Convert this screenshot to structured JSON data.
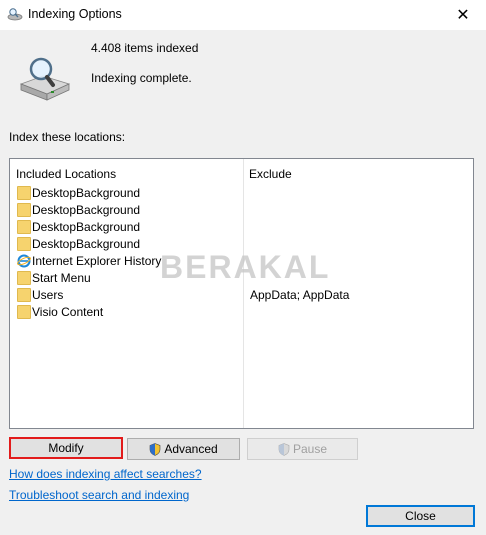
{
  "window": {
    "title": "Indexing Options",
    "close_glyph": "✕"
  },
  "status": {
    "items_indexed": "4.408 items indexed",
    "state": "Indexing complete."
  },
  "locations": {
    "label": "Index these locations:",
    "columns": {
      "included": "Included Locations",
      "exclude": "Exclude"
    },
    "rows": [
      {
        "name": "DesktopBackground",
        "icon": "folder-icon",
        "exclude": ""
      },
      {
        "name": "DesktopBackground",
        "icon": "folder-icon",
        "exclude": ""
      },
      {
        "name": "DesktopBackground",
        "icon": "folder-icon",
        "exclude": ""
      },
      {
        "name": "DesktopBackground",
        "icon": "folder-icon",
        "exclude": ""
      },
      {
        "name": "Internet Explorer History",
        "icon": "internet-explorer-icon",
        "exclude": ""
      },
      {
        "name": "Start Menu",
        "icon": "folder-icon",
        "exclude": ""
      },
      {
        "name": "Users",
        "icon": "folder-icon",
        "exclude": "AppData; AppData"
      },
      {
        "name": "Visio Content",
        "icon": "folder-icon",
        "exclude": ""
      }
    ]
  },
  "buttons": {
    "modify": "Modify",
    "advanced": "Advanced",
    "pause": "Pause",
    "close": "Close"
  },
  "links": {
    "how_indexing": "How does indexing affect searches?",
    "troubleshoot": "Troubleshoot search and indexing"
  },
  "watermark": "BERAKAL",
  "colors": {
    "highlight_border": "#e21b1b",
    "default_button_border": "#0078d7",
    "link": "#0066cc",
    "folder": "#f6d36e"
  }
}
